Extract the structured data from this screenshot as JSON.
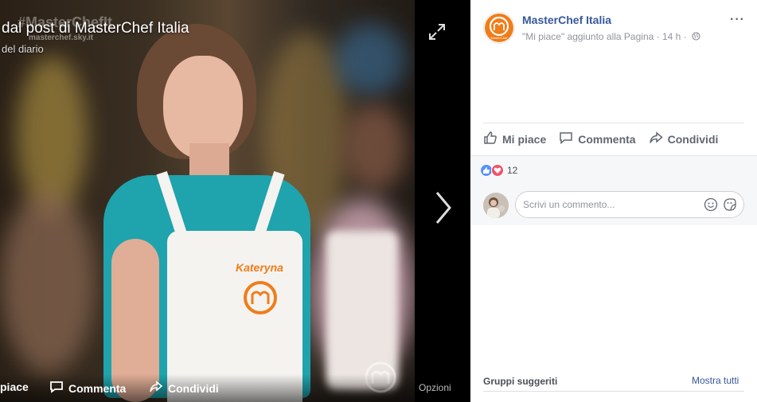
{
  "photo": {
    "watermark_text": "#MasterChefIt",
    "watermark_site": "masterchef.sky.it",
    "caption_title": "dal post di MasterChef Italia",
    "caption_sub": "del diario",
    "apron_name": "Kateryna",
    "footer": {
      "like_label": "piace",
      "comment_label": "Commenta",
      "share_label": "Condividi",
      "options_label": "Opzioni"
    }
  },
  "post": {
    "page_name": "MasterChef Italia",
    "meta": "\"Mi piace\" aggiunto alla Pagina · 14 h ·",
    "more_label": "···",
    "logo_label": "MasterChef",
    "actions": {
      "like_label": "Mi piace",
      "comment_label": "Commenta",
      "share_label": "Condividi"
    },
    "reactions": {
      "count": "12",
      "types": [
        "like-icon",
        "love-icon"
      ]
    },
    "comment_placeholder": "Scrivi un commento..."
  },
  "suggested": {
    "title": "Gruppi suggeriti",
    "see_all": "Mostra tutti"
  },
  "colors": {
    "accent_blue": "#365899",
    "brand_orange": "#f07d1a",
    "like_blue": "#5890ff",
    "love_red": "#f25268"
  }
}
